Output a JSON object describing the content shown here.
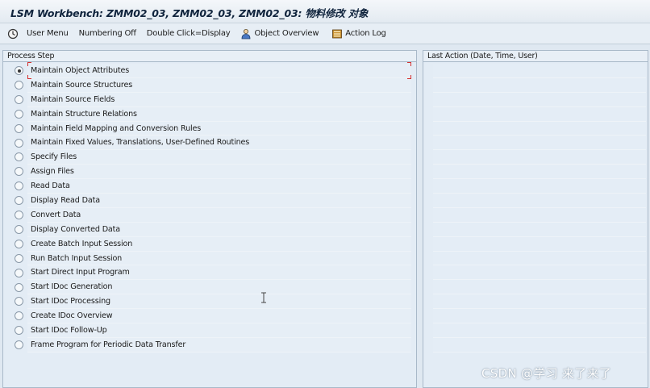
{
  "window": {
    "title": "LSM Workbench: ZMM02_03, ZMM02_03, ZMM02_03: 物料修改 对象"
  },
  "toolbar": {
    "user_menu": "User Menu",
    "numbering": "Numbering Off",
    "double_click": "Double Click=Display",
    "object_overview": "Object Overview",
    "action_log": "Action Log"
  },
  "process_panel": {
    "header": "Process Step",
    "selected_index": 0,
    "steps": [
      {
        "label": "Maintain Object Attributes"
      },
      {
        "label": "Maintain Source Structures"
      },
      {
        "label": "Maintain Source Fields"
      },
      {
        "label": "Maintain Structure Relations"
      },
      {
        "label": "Maintain Field Mapping and Conversion Rules"
      },
      {
        "label": "Maintain Fixed Values, Translations, User-Defined Routines"
      },
      {
        "label": "Specify Files"
      },
      {
        "label": "Assign Files"
      },
      {
        "label": "Read Data"
      },
      {
        "label": "Display Read Data"
      },
      {
        "label": "Convert Data"
      },
      {
        "label": "Display Converted Data"
      },
      {
        "label": "Create Batch Input Session"
      },
      {
        "label": "Run Batch Input Session"
      },
      {
        "label": "Start Direct Input Program"
      },
      {
        "label": "Start IDoc Generation"
      },
      {
        "label": "Start IDoc Processing"
      },
      {
        "label": "Create IDoc Overview"
      },
      {
        "label": "Start IDoc Follow-Up"
      },
      {
        "label": "Frame Program for Periodic Data Transfer"
      }
    ]
  },
  "action_panel": {
    "header": "Last Action (Date, Time, User)"
  },
  "watermark": "CSDN @学习 来了来了"
}
